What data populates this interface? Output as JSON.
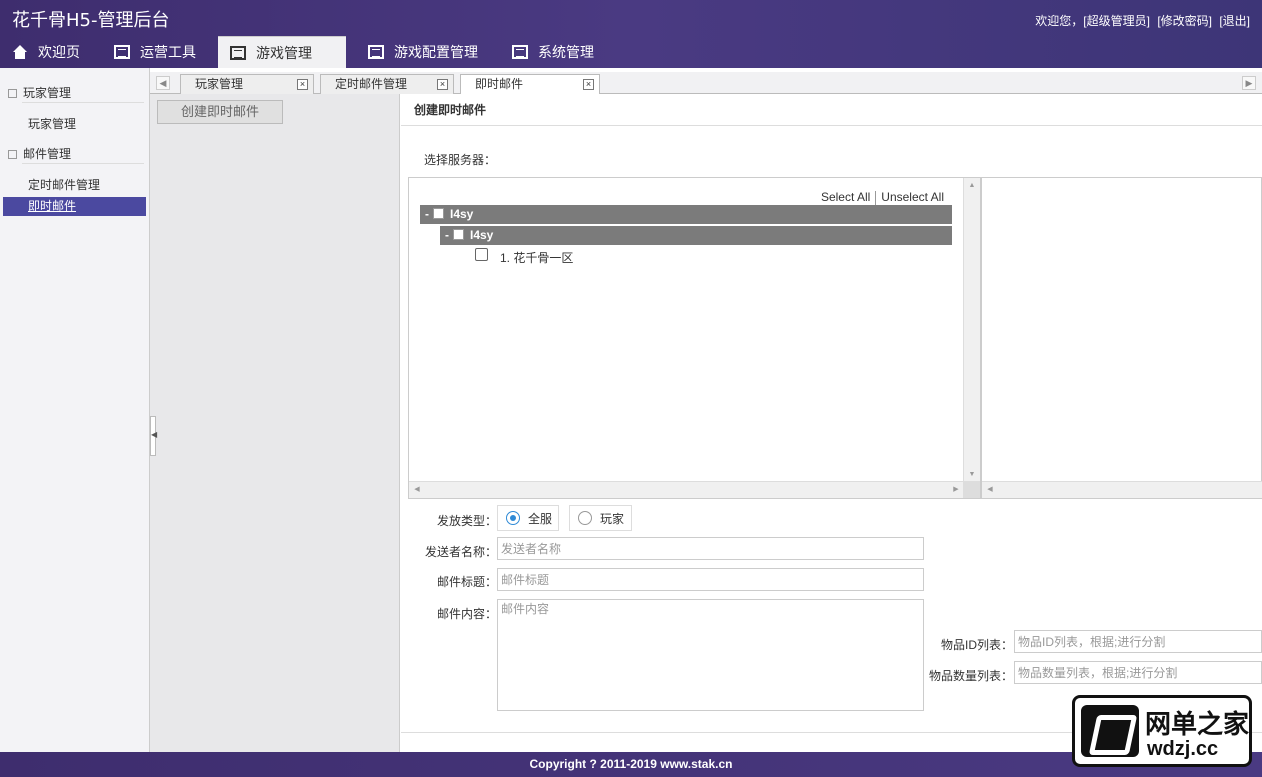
{
  "header": {
    "title": "花千骨H5-管理后台",
    "welcome": "欢迎您，[超级管理员]",
    "change_password": "[修改密码]",
    "logout": "[退出]"
  },
  "nav": [
    {
      "label": "欢迎页",
      "icon": "home-icon"
    },
    {
      "label": "运营工具",
      "icon": "list-icon"
    },
    {
      "label": "游戏管理",
      "icon": "list-icon",
      "active": true
    },
    {
      "label": "游戏配置管理",
      "icon": "list-icon"
    },
    {
      "label": "系统管理",
      "icon": "list-icon"
    }
  ],
  "sidebar": {
    "groups": [
      {
        "label": "玩家管理",
        "items": [
          "玩家管理"
        ]
      },
      {
        "label": "邮件管理",
        "items": [
          "定时邮件管理",
          "即时邮件"
        ]
      }
    ],
    "active_item": "即时邮件"
  },
  "tabs": [
    {
      "label": "玩家管理"
    },
    {
      "label": "定时邮件管理"
    },
    {
      "label": "即时邮件",
      "active": true
    }
  ],
  "tab_close_glyph": "×",
  "midpanel": {
    "create_button": "创建即时邮件"
  },
  "content": {
    "title": "创建即时邮件",
    "select_server_label": "选择服务器：",
    "select_all": "Select All",
    "unselect_all": "Unselect All",
    "tree": {
      "root": "I4sy",
      "child": "I4sy",
      "leaf": "1. 花千骨一区",
      "expander": "-"
    },
    "send_type_label": "发放类型：",
    "send_type_options": [
      "全服",
      "玩家"
    ],
    "send_type_selected": "全服",
    "sender_label": "发送者名称：",
    "sender_placeholder": "发送者名称",
    "mail_title_label": "邮件标题：",
    "mail_title_placeholder": "邮件标题",
    "mail_content_label": "邮件内容：",
    "mail_content_placeholder": "邮件内容",
    "item_ids_label": "物品ID列表：",
    "item_ids_placeholder": "物品ID列表，根据;进行分割",
    "item_counts_label": "物品数量列表：",
    "item_counts_placeholder": "物品数量列表，根据;进行分割"
  },
  "footer": {
    "copyright": "Copyright ? 2011-2019 www.stak.cn"
  },
  "watermark_logo": {
    "cn": "网单之家",
    "en": "wdzj.cc"
  },
  "colors": {
    "header_bg": "#3e2d6e",
    "active_sidebar": "#4b49a0",
    "tree_node_bg": "#7b7b7b",
    "radio_accent": "#2f8ad6"
  }
}
